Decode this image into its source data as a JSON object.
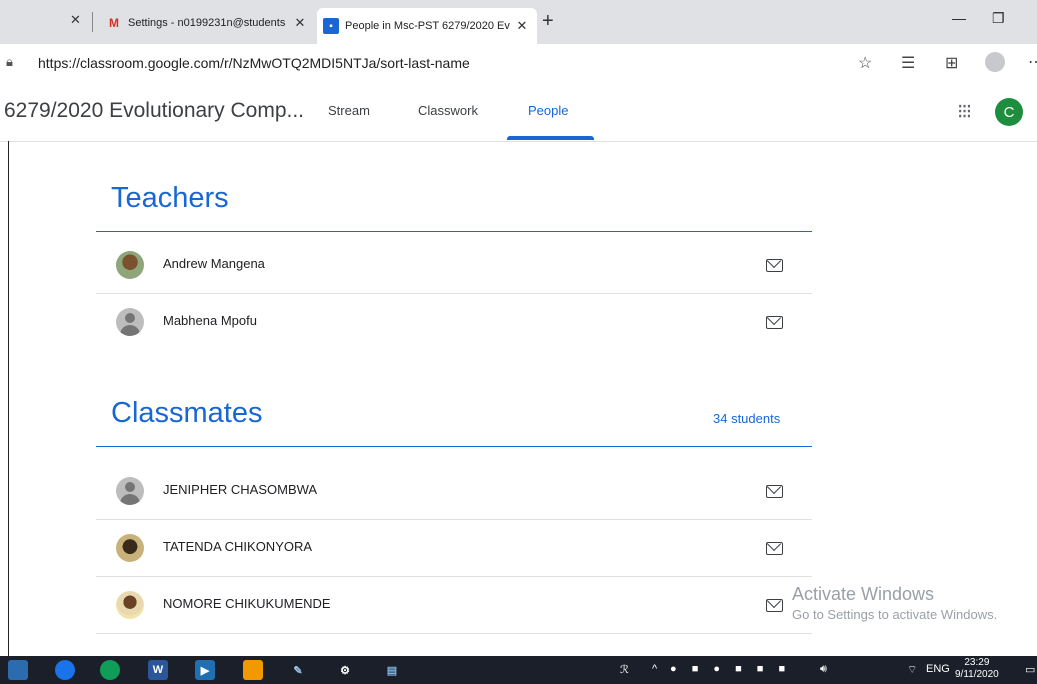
{
  "browser": {
    "tabs": [
      {
        "title": "Settings - n0199231n@students",
        "favicon": "gmail-icon"
      },
      {
        "title": "People in Msc-PST 6279/2020 Ev",
        "favicon": "classroom-icon"
      }
    ],
    "url": "https://classroom.google.com/r/NzMwOTQ2MDI5NTJa/sort-last-name"
  },
  "app": {
    "class_name": "6279/2020 Evolutionary Comp...",
    "nav": [
      "Stream",
      "Classwork",
      "People"
    ],
    "active_nav": "People",
    "account_initial": "C",
    "accent_color": "#1967d2"
  },
  "teachers": {
    "title": "Teachers",
    "people": [
      {
        "name": "Andrew Mangena",
        "avatar": "photo"
      },
      {
        "name": "Mabhena Mpofu",
        "avatar": "generic"
      }
    ]
  },
  "classmates": {
    "title": "Classmates",
    "count": "34 students",
    "people": [
      {
        "name": "JENIPHER CHASOMBWA",
        "avatar": "generic"
      },
      {
        "name": "TATENDA CHIKONYORA",
        "avatar": "photo"
      },
      {
        "name": "NOMORE CHIKUKUMENDE",
        "avatar": "photo"
      }
    ]
  },
  "watermark": {
    "line1": "Activate Windows",
    "line2": "Go to Settings to activate Windows."
  },
  "taskbar": {
    "language": "ENG",
    "time": "23:29",
    "date": "9/11/2020"
  }
}
